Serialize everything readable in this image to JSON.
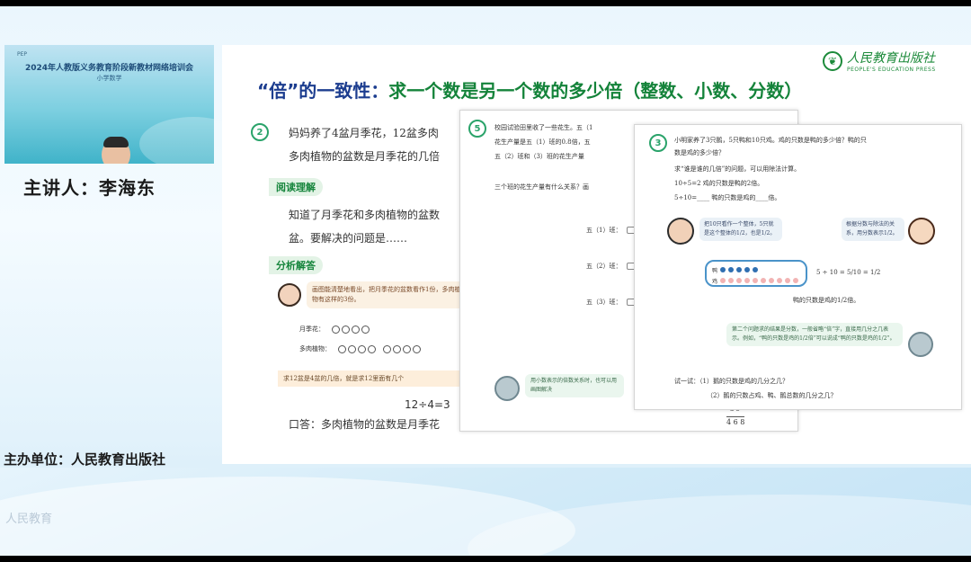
{
  "video": {
    "title": "2024年人教版义务教育阶段新教材网络培训会",
    "subtitle": "小学数学"
  },
  "speaker": "主讲人：李海东",
  "organizer": "主办单位：人民教育出版社",
  "publisher": {
    "name_cn": "人民教育出版社",
    "name_en": "PEOPLE'S EDUCATION PRESS"
  },
  "slide": {
    "title_part1": "“倍”的一致性：",
    "title_part2": "求一个数是另一个数的多少倍（整数、小数、分数）"
  },
  "page1": {
    "num": "2",
    "q_line1": "妈妈养了4盆月季花，12盆多肉",
    "q_line2": "多肉植物的盆数是月季花的几倍",
    "section_read": "阅读理解",
    "read_line1": "知道了月季花和多肉植物的盆数",
    "read_line2": "盆。要解决的问题是……",
    "section_solve": "分析解答",
    "bubble": "画图能清楚地看出，把月季花的盆数看作1份，多肉植物有这样的3份。",
    "row1_label": "月季花：",
    "row2_label": "多肉植物：",
    "note": "求12盆是4盆的几倍，就是求12里面有几个",
    "equation": "12÷4=3",
    "answer": "口答：多肉植物的盆数是月季花"
  },
  "page2": {
    "num": "5",
    "line1": "校园试验田里收了一些花生。五（1",
    "line2": "花生产量是五（1）班的0.8倍，五",
    "line3": "五（2）班和（3）班的花生产量",
    "line4": "三个班的花生产量有什么关系？画",
    "ruler1": "五（1）班：",
    "ruler2": "五（2）班：",
    "ruler3": "五（3）班：",
    "bubble": "用小数表示的倍数关系时，也可以用画图解决",
    "calc_top": "3 9",
    "calc_bottom": "4 6 8"
  },
  "page3": {
    "num": "3",
    "line1": "小明家养了3只鹅，5只鸭和10只鸡。鸡的只数是鸭的多少倍？鸭的只",
    "line2": "数是鸡的多少倍？",
    "line3": "求“谁是谁的几倍”的问题，可以用除法计算。",
    "line4": "10÷5=2          鸡的只数是鸭的2倍。",
    "line5": "5÷10=____        鸭的只数是鸡的____倍。",
    "bubble1": "把10只看作一个整体，5只就是这个整体的1/2，也是1/2。",
    "bubble2": "根据分数与除法的关系，用分数表示1/2。",
    "dots_row1": "鸭",
    "dots_row2": "鸡",
    "frac": "5 ÷ 10 = 5/10 = 1/2",
    "result": "鸭的只数是鸡的1/2倍。",
    "bubble3": "第二个问题求的结果是分数，一般省略“倍”字，直接用几分之几表示。例如，“鸭的只数是鸡的1/2倍”可以说成“鸭的只数是鸡的1/2”。",
    "try1": "试一试：（1）鹅的只数是鸡的几分之几？",
    "try2": "（2）鹅的只数占鸡、鸭、鹅总数的几分之几？"
  },
  "watermark": "人民教育"
}
